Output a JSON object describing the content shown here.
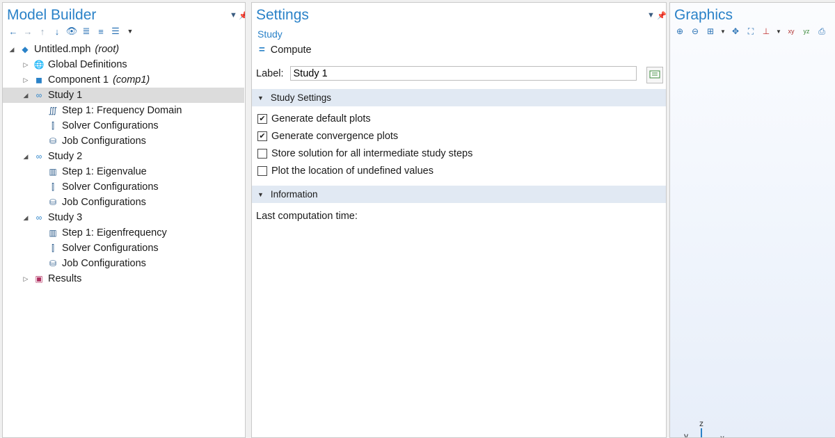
{
  "model_builder": {
    "title": "Model Builder",
    "tree": [
      {
        "label": "Untitled.mph",
        "tag": "(root)",
        "icon": "root-model-icon",
        "twist": "expanded"
      },
      {
        "label": "Global Definitions",
        "tag": "",
        "icon": "globe-icon",
        "twist": "collapsed"
      },
      {
        "label": "Component 1",
        "tag": "(comp1)",
        "icon": "component-icon",
        "twist": "collapsed"
      },
      {
        "label": "Study 1",
        "tag": "",
        "icon": "study-icon",
        "twist": "expanded",
        "selected": true
      },
      {
        "label": "Step 1: Frequency Domain",
        "tag": "",
        "icon": "frequency-domain-icon",
        "twist": "none"
      },
      {
        "label": "Solver Configurations",
        "tag": "",
        "icon": "solver-config-icon",
        "twist": "none"
      },
      {
        "label": "Job Configurations",
        "tag": "",
        "icon": "job-config-icon",
        "twist": "none"
      },
      {
        "label": "Study 2",
        "tag": "",
        "icon": "study-icon",
        "twist": "expanded"
      },
      {
        "label": "Step 1: Eigenvalue",
        "tag": "",
        "icon": "eigenvalue-icon",
        "twist": "none"
      },
      {
        "label": "Solver Configurations",
        "tag": "",
        "icon": "solver-config-icon",
        "twist": "none"
      },
      {
        "label": "Job Configurations",
        "tag": "",
        "icon": "job-config-icon",
        "twist": "none"
      },
      {
        "label": "Study 3",
        "tag": "",
        "icon": "study-icon",
        "twist": "expanded"
      },
      {
        "label": "Step 1: Eigenfrequency",
        "tag": "",
        "icon": "eigenfrequency-icon",
        "twist": "none"
      },
      {
        "label": "Solver Configurations",
        "tag": "",
        "icon": "solver-config-icon",
        "twist": "none"
      },
      {
        "label": "Job Configurations",
        "tag": "",
        "icon": "job-config-icon",
        "twist": "none"
      },
      {
        "label": "Results",
        "tag": "",
        "icon": "results-icon",
        "twist": "collapsed"
      }
    ]
  },
  "settings": {
    "title": "Settings",
    "subtitle": "Study",
    "compute_label": "Compute",
    "label_caption": "Label:",
    "label_value": "Study 1",
    "study_settings_header": "Study Settings",
    "checkboxes": [
      {
        "label": "Generate default plots",
        "checked": true
      },
      {
        "label": "Generate convergence plots",
        "checked": true
      },
      {
        "label": "Store solution for all intermediate study steps",
        "checked": false
      },
      {
        "label": "Plot the location of undefined values",
        "checked": false
      }
    ],
    "information_header": "Information",
    "last_computation_label": "Last computation time:"
  },
  "graphics": {
    "title": "Graphics",
    "axis_labels": {
      "z": "z",
      "y": "y",
      "x": "x"
    }
  },
  "colors": {
    "accent": "#2a82c8",
    "section_header": "#e1e9f3",
    "selection": "#dcdcdc"
  }
}
